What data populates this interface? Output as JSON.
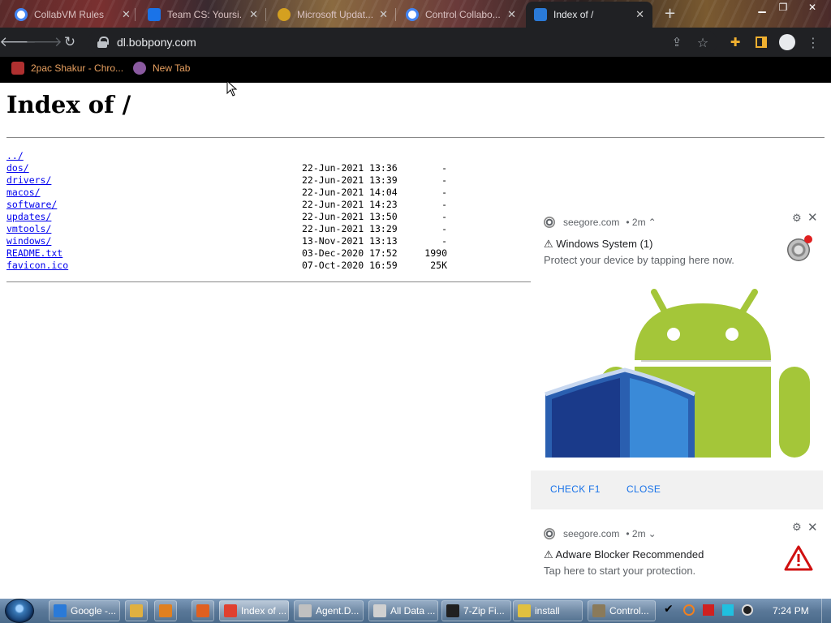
{
  "browser": {
    "tabs": [
      {
        "title": "CollabVM Rules",
        "favicon_color": "#ffffff"
      },
      {
        "title": "Team CS: Yoursi...",
        "favicon_color": "#1a73e8"
      },
      {
        "title": "Microsoft Updat...",
        "favicon_color": "#d4a020"
      },
      {
        "title": "Control Collabo...",
        "favicon_color": "#ffffff"
      },
      {
        "title": "Index of /",
        "favicon_color": "#2a7ad8"
      }
    ],
    "tab_close_glyph": "✕",
    "new_tab_glyph": "+",
    "address": "dl.bobpony.com",
    "bookmarks": [
      {
        "label": "2pac Shakur - Chro...",
        "icon_color": "#b03030"
      },
      {
        "label": "New Tab",
        "icon_color": "#8a5aa0"
      }
    ]
  },
  "page": {
    "title": "Index of /",
    "entries": [
      {
        "name": "../",
        "date": "",
        "size": ""
      },
      {
        "name": "dos/",
        "date": "22-Jun-2021 13:36",
        "size": "-"
      },
      {
        "name": "drivers/",
        "date": "22-Jun-2021 13:39",
        "size": "-"
      },
      {
        "name": "macos/",
        "date": "22-Jun-2021 14:04",
        "size": "-"
      },
      {
        "name": "software/",
        "date": "22-Jun-2021 14:23",
        "size": "-"
      },
      {
        "name": "updates/",
        "date": "22-Jun-2021 13:50",
        "size": "-"
      },
      {
        "name": "vmtools/",
        "date": "22-Jun-2021 13:29",
        "size": "-"
      },
      {
        "name": "windows/",
        "date": "13-Nov-2021 13:13",
        "size": "-"
      },
      {
        "name": "README.txt",
        "date": "03-Dec-2020 17:52",
        "size": "1990"
      },
      {
        "name": "favicon.ico",
        "date": "07-Oct-2020 16:59",
        "size": "25K"
      }
    ]
  },
  "notifications": [
    {
      "source": "seegore.com",
      "age": "• 2m",
      "expand_glyph": "⌃",
      "title": "⚠ Windows System (1)",
      "body": "Protect your device by tapping here now.",
      "actions": [
        "CHECK F1",
        "CLOSE"
      ]
    },
    {
      "source": "seegore.com",
      "age": "• 2m",
      "expand_glyph": "⌄",
      "title": "⚠ Adware Blocker Recommended",
      "body": "Tap here to start your protection."
    }
  ],
  "taskbar": {
    "items": [
      {
        "label": "Google -...",
        "icon_color": "#2a7ad8"
      },
      {
        "label": "",
        "icon_color": "#e0b040"
      },
      {
        "label": "",
        "icon_color": "#e08020"
      },
      {
        "label": "",
        "icon_color": "#e06020"
      },
      {
        "label": "Index of ...",
        "icon_color": "#e04030"
      },
      {
        "label": "Agent.D...",
        "icon_color": "#c0c0c0"
      },
      {
        "label": "All Data ...",
        "icon_color": "#d0d0d0"
      },
      {
        "label": "7-Zip Fi...",
        "icon_color": "#202020"
      },
      {
        "label": "install",
        "icon_color": "#e0c040"
      },
      {
        "label": "Control...",
        "icon_color": "#8a7a5a"
      }
    ],
    "clock": "7:24 PM"
  }
}
